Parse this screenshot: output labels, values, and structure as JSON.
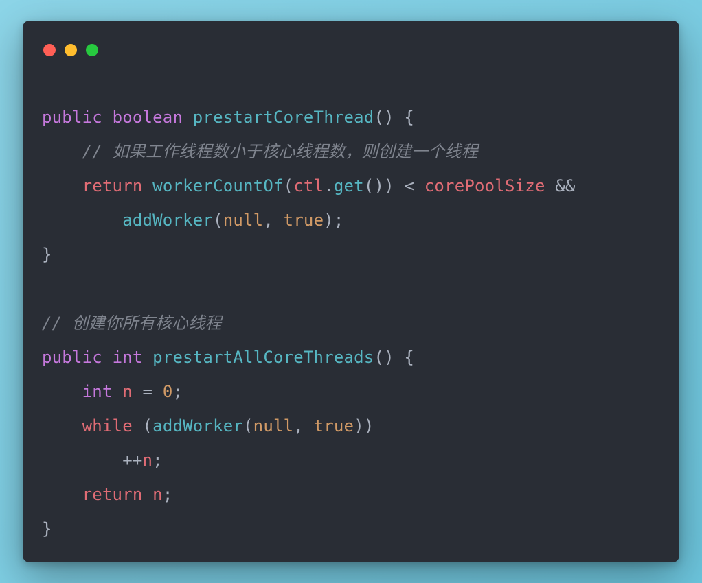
{
  "colors": {
    "bg_gradient_from": "#8dd5e8",
    "bg_gradient_to": "#6cc5dd",
    "window_bg": "#292d35",
    "traffic_red": "#ff5f56",
    "traffic_yellow": "#ffbd2e",
    "traffic_green": "#27c93f"
  },
  "code": {
    "lines": [
      [
        {
          "t": "public",
          "c": "keyword"
        },
        {
          "t": " ",
          "c": "punct"
        },
        {
          "t": "boolean",
          "c": "keyword"
        },
        {
          "t": " ",
          "c": "punct"
        },
        {
          "t": "prestartCoreThread",
          "c": "func"
        },
        {
          "t": "() {",
          "c": "punct"
        }
      ],
      [
        {
          "t": "    ",
          "c": "punct"
        },
        {
          "t": "// 如果工作线程数小于核心线程数，则创建一个线程",
          "c": "comment"
        }
      ],
      [
        {
          "t": "    ",
          "c": "punct"
        },
        {
          "t": "return",
          "c": "return"
        },
        {
          "t": " ",
          "c": "punct"
        },
        {
          "t": "workerCountOf",
          "c": "func"
        },
        {
          "t": "(",
          "c": "punct"
        },
        {
          "t": "ctl",
          "c": "idred"
        },
        {
          "t": ".",
          "c": "punct"
        },
        {
          "t": "get",
          "c": "func"
        },
        {
          "t": "()) < ",
          "c": "punct"
        },
        {
          "t": "corePoolSize",
          "c": "idred"
        },
        {
          "t": " &&",
          "c": "punct"
        }
      ],
      [
        {
          "t": "        ",
          "c": "punct"
        },
        {
          "t": "addWorker",
          "c": "func"
        },
        {
          "t": "(",
          "c": "punct"
        },
        {
          "t": "null",
          "c": "null"
        },
        {
          "t": ", ",
          "c": "punct"
        },
        {
          "t": "true",
          "c": "null"
        },
        {
          "t": ");",
          "c": "punct"
        }
      ],
      [
        {
          "t": "}",
          "c": "punct"
        }
      ],
      [
        {
          "t": "",
          "c": "punct"
        }
      ],
      [
        {
          "t": "// 创建你所有核心线程",
          "c": "comment"
        }
      ],
      [
        {
          "t": "public",
          "c": "keyword"
        },
        {
          "t": " ",
          "c": "punct"
        },
        {
          "t": "int",
          "c": "keyword"
        },
        {
          "t": " ",
          "c": "punct"
        },
        {
          "t": "prestartAllCoreThreads",
          "c": "func"
        },
        {
          "t": "() {",
          "c": "punct"
        }
      ],
      [
        {
          "t": "    ",
          "c": "punct"
        },
        {
          "t": "int",
          "c": "keyword"
        },
        {
          "t": " ",
          "c": "punct"
        },
        {
          "t": "n",
          "c": "idred"
        },
        {
          "t": " = ",
          "c": "punct"
        },
        {
          "t": "0",
          "c": "num"
        },
        {
          "t": ";",
          "c": "punct"
        }
      ],
      [
        {
          "t": "    ",
          "c": "punct"
        },
        {
          "t": "while",
          "c": "return"
        },
        {
          "t": " (",
          "c": "punct"
        },
        {
          "t": "addWorker",
          "c": "func"
        },
        {
          "t": "(",
          "c": "punct"
        },
        {
          "t": "null",
          "c": "null"
        },
        {
          "t": ", ",
          "c": "punct"
        },
        {
          "t": "true",
          "c": "null"
        },
        {
          "t": "))",
          "c": "punct"
        }
      ],
      [
        {
          "t": "        ++",
          "c": "punct"
        },
        {
          "t": "n",
          "c": "idred"
        },
        {
          "t": ";",
          "c": "punct"
        }
      ],
      [
        {
          "t": "    ",
          "c": "punct"
        },
        {
          "t": "return",
          "c": "return"
        },
        {
          "t": " ",
          "c": "punct"
        },
        {
          "t": "n",
          "c": "idred"
        },
        {
          "t": ";",
          "c": "punct"
        }
      ],
      [
        {
          "t": "}",
          "c": "punct"
        }
      ]
    ]
  }
}
